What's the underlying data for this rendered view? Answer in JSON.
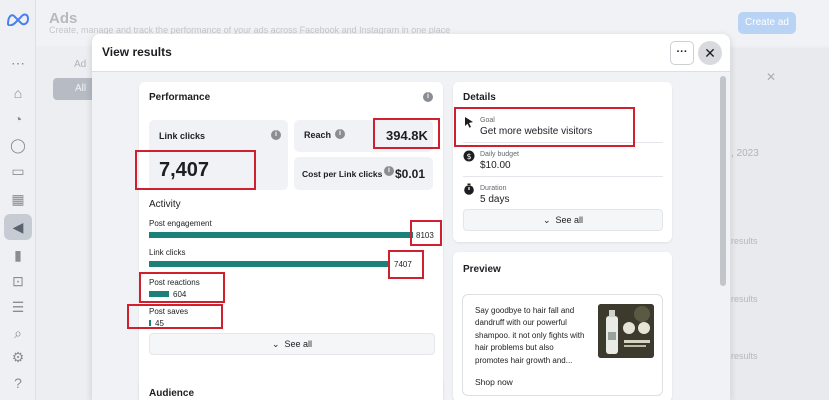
{
  "background": {
    "title": "Ads",
    "subtitle": "Create, manage and track the performance of your ads across Facebook and Instagram in one place",
    "create_button": "Create ad",
    "tab_all": "All",
    "tab_ad": "Ad",
    "date_fragment": ", 2023",
    "row_fragments": [
      "results",
      "results",
      "results"
    ]
  },
  "modal": {
    "title": "View results",
    "more_label": "···",
    "close_label": "✕"
  },
  "performance": {
    "title": "Performance",
    "link_clicks": {
      "label": "Link clicks",
      "value": "7,407"
    },
    "reach": {
      "label": "Reach",
      "value": "394.8K"
    },
    "cost_per_link_click": {
      "label": "Cost per Link clicks",
      "value": "$0.01"
    },
    "activity": {
      "title": "Activity",
      "max": 8103,
      "items": [
        {
          "label": "Post engagement",
          "value": 8103,
          "display": "8103"
        },
        {
          "label": "Link clicks",
          "value": 7407,
          "display": "7407"
        },
        {
          "label": "Post reactions",
          "value": 604,
          "display": "604"
        },
        {
          "label": "Post saves",
          "value": 45,
          "display": "45"
        }
      ]
    },
    "see_all": "See all"
  },
  "details": {
    "title": "Details",
    "goal": {
      "label": "Goal",
      "value": "Get more website visitors"
    },
    "daily_budget": {
      "label": "Daily budget",
      "value": "$10.00"
    },
    "duration": {
      "label": "Duration",
      "value": "5 days"
    },
    "see_all": "See all"
  },
  "preview": {
    "title": "Preview",
    "ad_text": "Say goodbye to hair fall and dandruff with our powerful shampoo. it not only fights with hair problems but also promotes hair growth and...",
    "cta": "Shop now"
  },
  "audience": {
    "title": "Audience"
  },
  "colors": {
    "accent": "#1b7f7a",
    "highlight": "#d01f2e"
  }
}
